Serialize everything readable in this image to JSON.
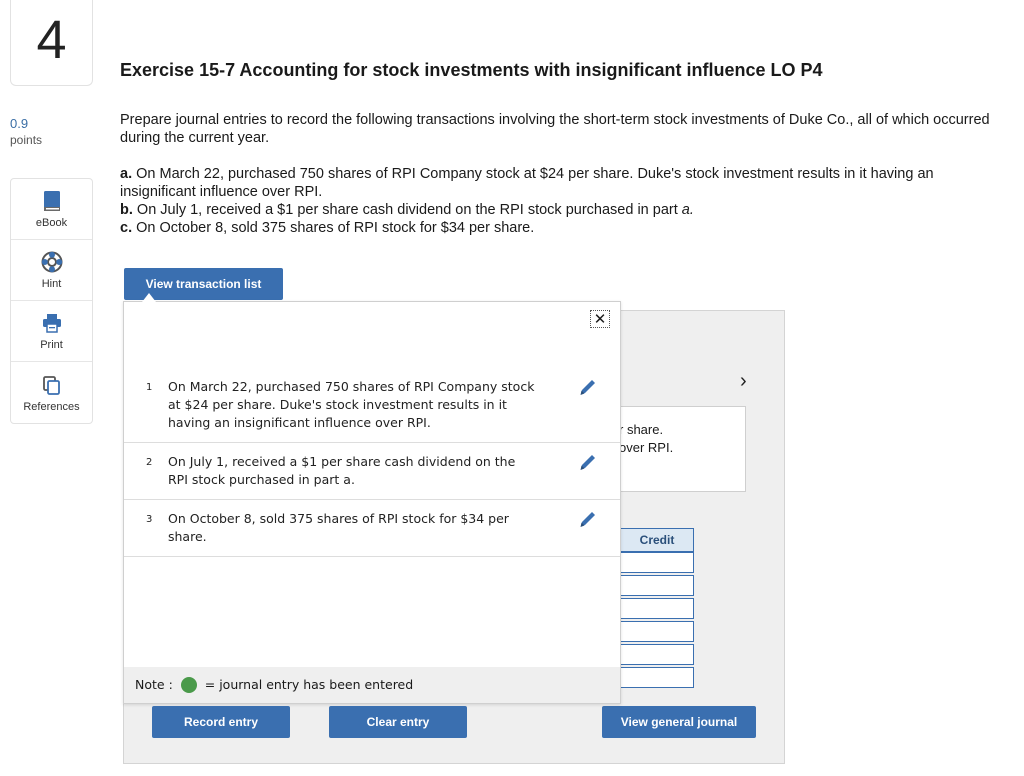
{
  "question": {
    "number": "4",
    "points_value": "0.9",
    "points_label": "points"
  },
  "tools": [
    {
      "label": "eBook",
      "icon": "book-icon"
    },
    {
      "label": "Hint",
      "icon": "lifebuoy-icon"
    },
    {
      "label": "Print",
      "icon": "printer-icon"
    },
    {
      "label": "References",
      "icon": "copy-icon"
    }
  ],
  "exercise": {
    "title": "Exercise 15-7 Accounting for stock investments with insignificant influence LO P4",
    "intro": "Prepare journal entries to record the following transactions involving the short-term stock investments of Duke Co., all of which occurred during the current year.",
    "parts": [
      {
        "letter": "a.",
        "text": "On March 22, purchased 750 shares of RPI Company stock at $24 per share. Duke's stock investment results in it having an insignificant influence over RPI."
      },
      {
        "letter": "b.",
        "text": "On July 1, received a $1 per share cash dividend on the RPI stock purchased in part",
        "tail": "a."
      },
      {
        "letter": "c.",
        "text": "On October 8, sold 375 shares of RPI stock for $34 per share."
      }
    ]
  },
  "buttons": {
    "view_transaction_list": "View transaction list",
    "record_entry": "Record entry",
    "clear_entry": "Clear entry",
    "view_general_journal": "View general journal"
  },
  "popup": {
    "close_symbol": "✕",
    "transactions": [
      {
        "num": "1",
        "text": "On March 22, purchased 750 shares of RPI Company stock at $24 per share. Duke's stock investment results in it having an insignificant influence over RPI."
      },
      {
        "num": "2",
        "text": "On July 1, received a $1 per share cash dividend on the RPI stock purchased in part a."
      },
      {
        "num": "3",
        "text": "On October 8, sold 375 shares of RPI stock for $34 per share."
      }
    ],
    "note_label": "Note :",
    "note_text": "= journal entry has been entered"
  },
  "background": {
    "snippet_line1": "r share.",
    "snippet_line2": "over RPI.",
    "chevron": "›",
    "credit_header": "Credit"
  },
  "colors": {
    "accent_blue": "#3a6fb0",
    "entered_green": "#4a9a4a"
  }
}
